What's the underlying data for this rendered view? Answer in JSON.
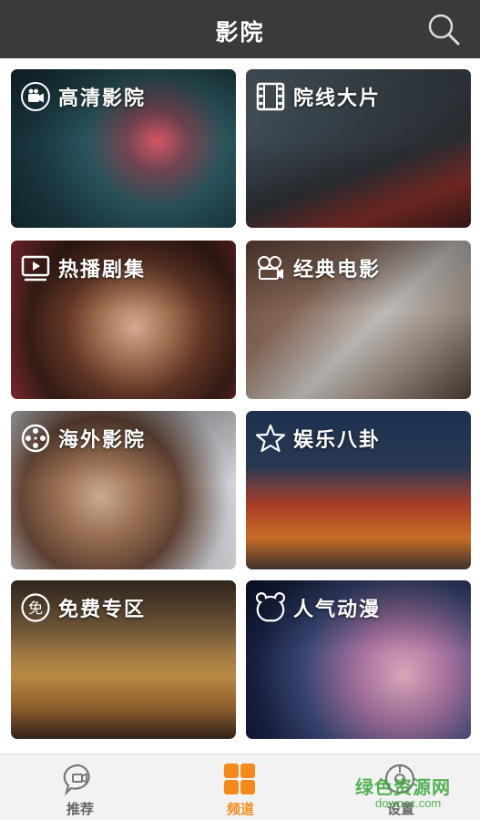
{
  "header": {
    "title": "影院",
    "search_icon": "search-icon"
  },
  "categories": [
    {
      "label": "高清影院",
      "icon": "camera-icon"
    },
    {
      "label": "院线大片",
      "icon": "film-strip-icon"
    },
    {
      "label": "热播剧集",
      "icon": "play-screen-icon"
    },
    {
      "label": "经典电影",
      "icon": "film-projector-icon"
    },
    {
      "label": "海外影院",
      "icon": "film-reel-icon"
    },
    {
      "label": "娱乐八卦",
      "icon": "star-icon"
    },
    {
      "label": "免费专区",
      "icon": "free-badge-icon"
    },
    {
      "label": "人气动漫",
      "icon": "bear-face-icon"
    }
  ],
  "bottom_nav": {
    "tabs": [
      {
        "label": "推荐",
        "icon": "video-chat-icon",
        "active": false
      },
      {
        "label": "频道",
        "icon": "grid-icon",
        "active": true
      },
      {
        "label": "设置",
        "icon": "settings-icon",
        "active": false
      }
    ]
  },
  "watermark": {
    "title": "绿色资源网",
    "url": "downcc.com"
  },
  "colors": {
    "header_bg": "#3a3a3a",
    "active_tab": "#f28a1e",
    "inactive_tab": "#666666",
    "watermark": "#3aa53a"
  }
}
